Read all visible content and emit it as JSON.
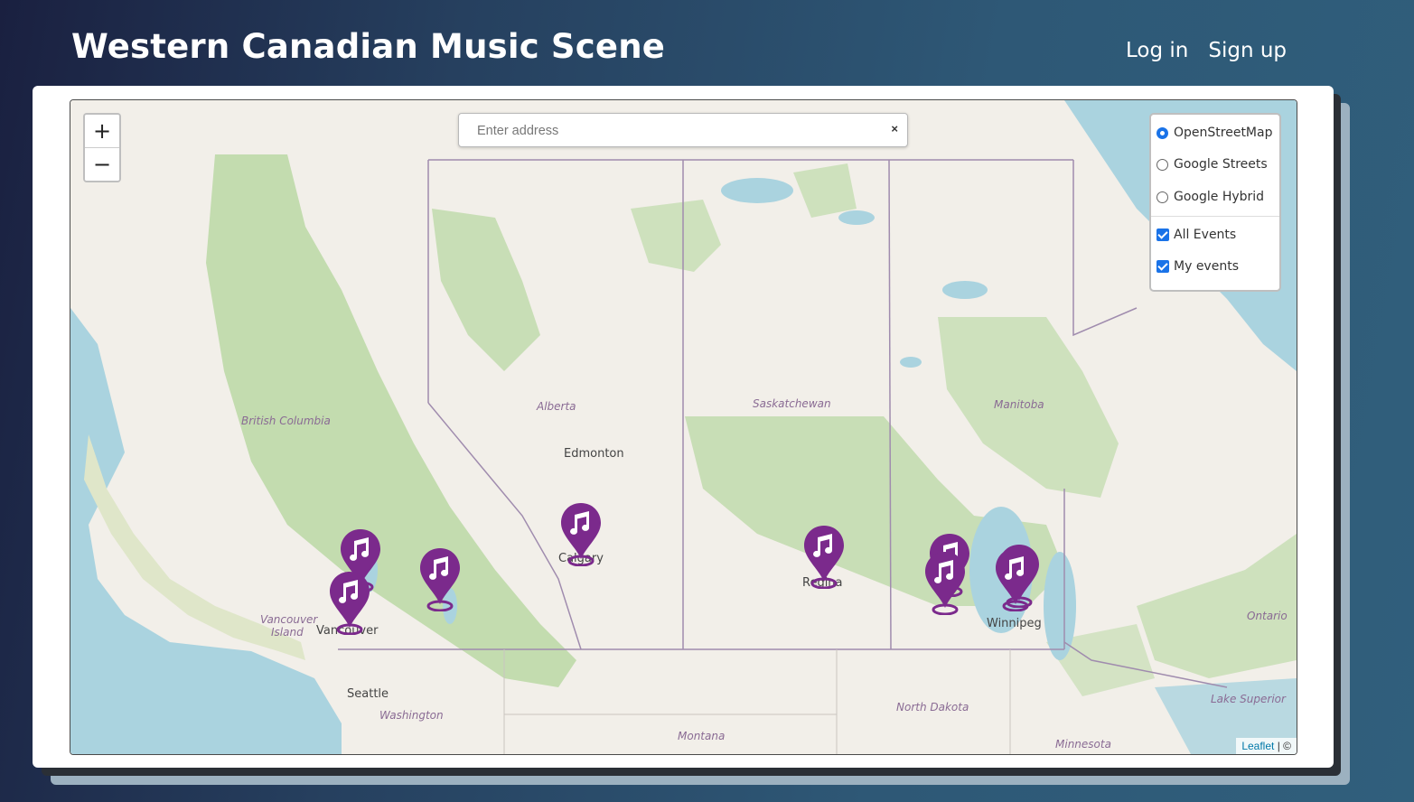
{
  "header": {
    "site_title": "Western Canadian Music Scene",
    "login_label": "Log in",
    "signup_label": "Sign up"
  },
  "map": {
    "zoom_in": "+",
    "zoom_out": "−",
    "search_placeholder": "Enter address",
    "search_clear": "×",
    "layers": {
      "base": [
        "OpenStreetMap",
        "Google Streets",
        "Google Hybrid"
      ],
      "selected_base": "OpenStreetMap",
      "overlays": [
        "All Events",
        "My events"
      ],
      "overlays_checked": [
        true,
        true
      ]
    },
    "labels": {
      "provinces": [
        "British Columbia",
        "Alberta",
        "Saskatchewan",
        "Manitoba",
        "Ontario"
      ],
      "cities": [
        "Edmonton",
        "Calgary",
        "Regina",
        "Winnipeg",
        "Vancouver",
        "Seattle"
      ],
      "regions": [
        "Vancouver",
        "Island",
        "Washington",
        "Montana",
        "North Dakota",
        "Minnesota",
        "Lake Superior"
      ]
    },
    "marker_icon": "music-note-map-pin-icon",
    "marker_color": "#7b2a8c",
    "attribution": {
      "link": "Leaflet",
      "rest": "| ©"
    }
  },
  "colors": {
    "land": "#f2efe9",
    "forest": "#b6d7a0",
    "water": "#aad3df",
    "border": "#a08cae"
  }
}
